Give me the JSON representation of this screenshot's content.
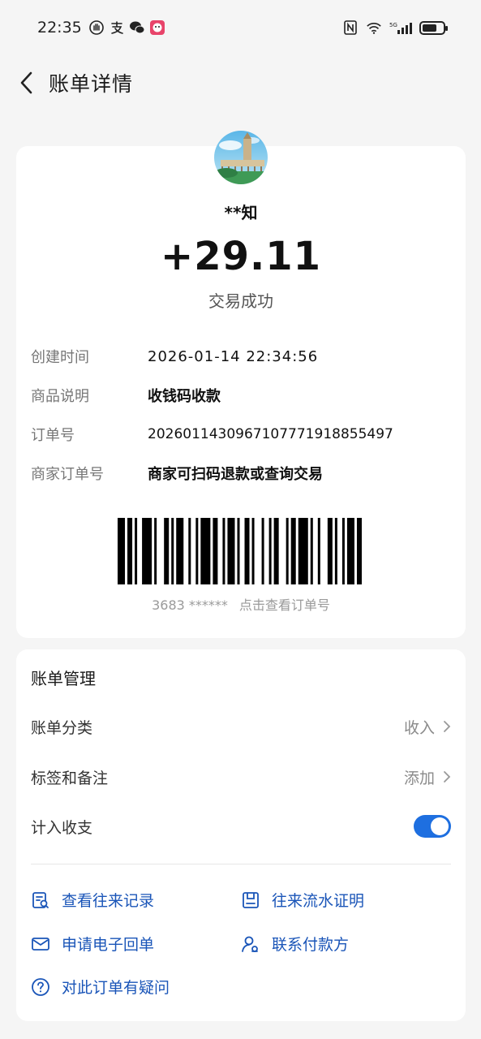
{
  "status_bar": {
    "time": "22:35",
    "signal_label": "5G"
  },
  "header": {
    "title": "账单详情"
  },
  "detail": {
    "payer_name": "**知",
    "amount": "+29.11",
    "status": "交易成功",
    "rows": [
      {
        "label": "创建时间",
        "value": "2026-01-14 22:34:56"
      },
      {
        "label": "商品说明",
        "value": "收钱码收款"
      },
      {
        "label": "订单号",
        "value": "20260114309671077719188554 97"
      },
      {
        "label": "商家订单号",
        "value": "商家可扫码退款或查询交易"
      }
    ],
    "barcode": {
      "masked_number": "3683 ******",
      "hint": "点击查看订单号"
    }
  },
  "manage": {
    "title": "账单管理",
    "category": {
      "label": "账单分类",
      "value": "收入"
    },
    "tags": {
      "label": "标签和备注",
      "value": "添加"
    },
    "count_in": {
      "label": "计入收支",
      "enabled": true
    },
    "actions": [
      {
        "label": "查看往来记录",
        "icon": "records-icon"
      },
      {
        "label": "往来流水证明",
        "icon": "statement-icon"
      },
      {
        "label": "申请电子回单",
        "icon": "mail-icon"
      },
      {
        "label": "联系付款方",
        "icon": "contact-payer-icon"
      },
      {
        "label": "对此订单有疑问",
        "icon": "question-icon"
      }
    ]
  },
  "colors": {
    "accent": "#1e6fe0",
    "link": "#1a55b8",
    "background": "#f5f5f5"
  }
}
